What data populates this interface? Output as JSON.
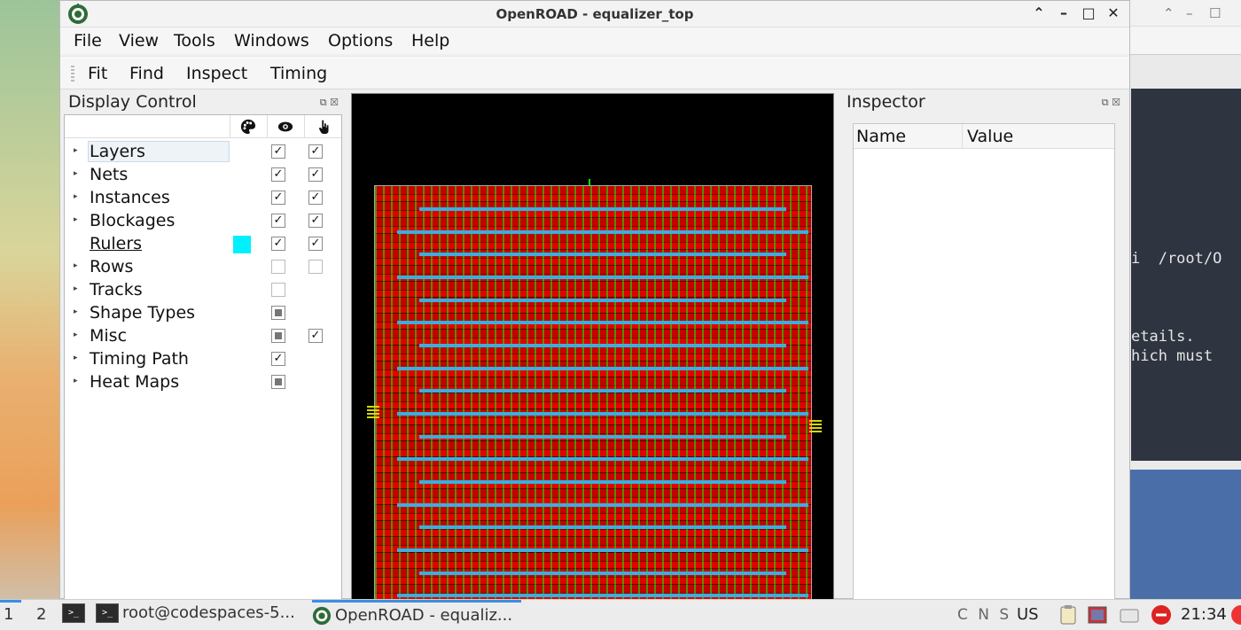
{
  "window": {
    "title": "OpenROAD - equalizer_top"
  },
  "menubar": {
    "items": [
      "File",
      "View",
      "Tools",
      "Windows",
      "Options",
      "Help"
    ]
  },
  "toolbar": {
    "items": [
      "Fit",
      "Find",
      "Inspect",
      "Timing"
    ]
  },
  "display_control": {
    "title": "Display Control",
    "columns": [
      "palette-icon",
      "eye-icon",
      "pointer-icon"
    ],
    "rows": [
      {
        "label": "Layers",
        "expandable": true,
        "selected": true,
        "visible": "checked",
        "selectable": "checked"
      },
      {
        "label": "Nets",
        "expandable": true,
        "visible": "checked",
        "selectable": "checked"
      },
      {
        "label": "Instances",
        "expandable": true,
        "visible": "checked",
        "selectable": "checked"
      },
      {
        "label": "Blockages",
        "expandable": true,
        "visible": "checked",
        "selectable": "checked"
      },
      {
        "label": "Rulers",
        "expandable": false,
        "color": "#00f0ff",
        "visible": "checked",
        "selectable": "checked"
      },
      {
        "label": "Rows",
        "expandable": true,
        "visible": "unchecked",
        "selectable": "unchecked"
      },
      {
        "label": "Tracks",
        "expandable": true,
        "visible": "unchecked"
      },
      {
        "label": "Shape Types",
        "expandable": true,
        "visible": "partial"
      },
      {
        "label": "Misc",
        "expandable": true,
        "visible": "partial",
        "selectable": "checked"
      },
      {
        "label": "Timing Path",
        "expandable": true,
        "visible": "checked"
      },
      {
        "label": "Heat Maps",
        "expandable": true,
        "visible": "partial"
      }
    ]
  },
  "inspector": {
    "title": "Inspector",
    "columns": [
      "Name",
      "Value"
    ]
  },
  "background_terminal": {
    "lines": [
      "i  /root/O",
      "etails.",
      "hich must"
    ]
  },
  "taskbar": {
    "workspaces": [
      "1",
      "2"
    ],
    "tasks": [
      "root@codespaces-5...",
      "OpenROAD - equaliz..."
    ],
    "indicators": "C N S",
    "keyboard": "US",
    "clock": "21:34"
  },
  "colors": {
    "ruler": "#00f0ff",
    "die_fill": "#c40000",
    "routing": "#00ff00",
    "power_stripe": "#3aaee0"
  }
}
